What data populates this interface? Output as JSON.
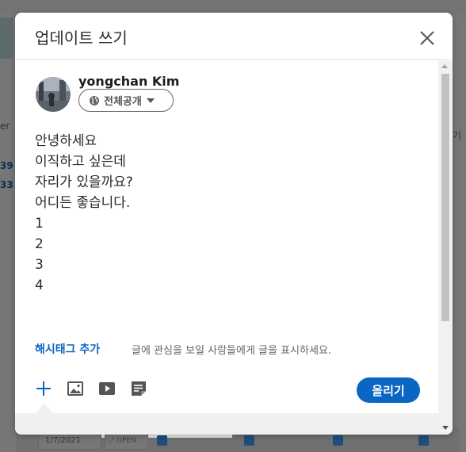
{
  "modal": {
    "title": "업데이트 쓰기",
    "close_label": "×"
  },
  "author": {
    "name": "yongchan Kim",
    "visibility": "전체공개"
  },
  "post": {
    "lines": [
      "안녕하세요",
      "이직하고 싶은데",
      "자리가 있을까요?",
      "어디든 좋습니다.",
      "1",
      "2",
      "3",
      "4"
    ]
  },
  "hashtag": {
    "link_label": "해시태그 추가",
    "hint": "글에 관심을 보일 사람들에게 글을 표시하세요."
  },
  "toolbar": {
    "icons": [
      "plus-icon",
      "image-icon",
      "video-icon",
      "document-icon"
    ],
    "post_label": "올리기"
  },
  "background": {
    "left_text_1": "er",
    "link_1": "39",
    "link_2": "33",
    "right_text": "기",
    "date": "1/7/2021",
    "open_label": "OPEN"
  },
  "colors": {
    "accent": "#0a66c2",
    "overlay": "#767676"
  }
}
